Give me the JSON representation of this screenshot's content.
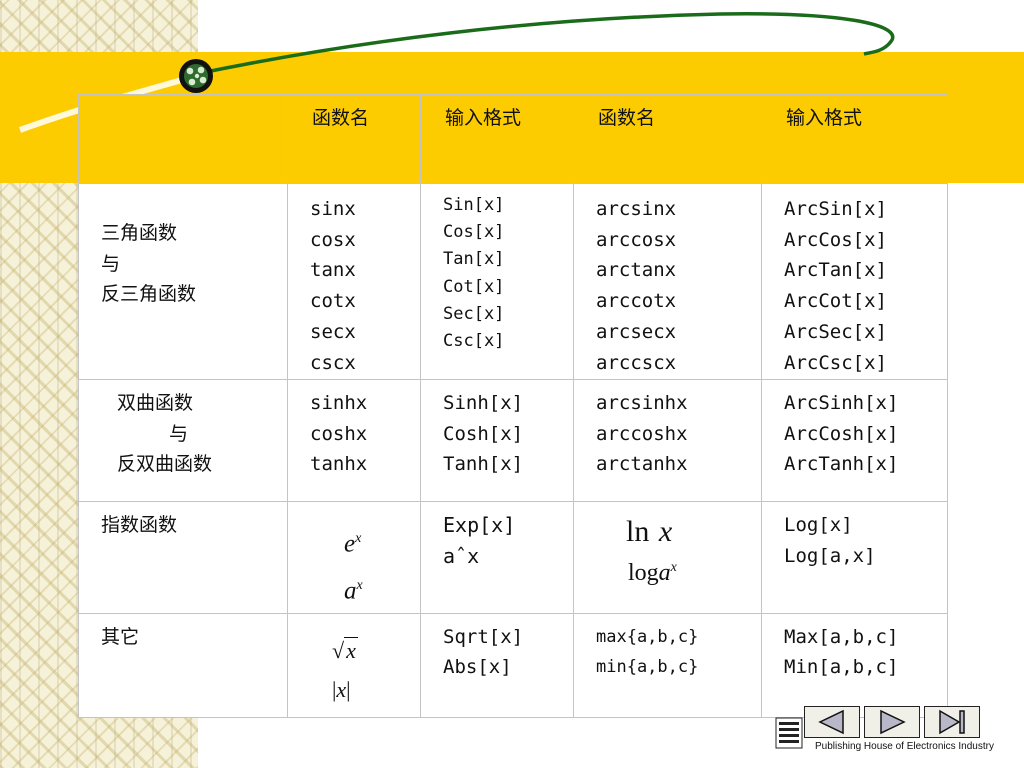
{
  "table": {
    "headers": [
      "函数名",
      "输入格式",
      "函数名",
      "输入格式"
    ],
    "rows": [
      {
        "category": [
          "三角函数",
          "与",
          "反三角函数"
        ],
        "names1": [
          "sinx",
          "cosx",
          "tanx",
          "cotx",
          "secx",
          "cscx"
        ],
        "formats1": [
          "Sin[x]",
          "Cos[x]",
          "Tan[x]",
          "Cot[x]",
          "Sec[x]",
          "Csc[x]"
        ],
        "names2": [
          "arcsinx",
          "arccosx",
          "arctanx",
          "arccotx",
          "arcsecx",
          "arccscx"
        ],
        "formats2": [
          "ArcSin[x]",
          "ArcCos[x]",
          "ArcTan[x]",
          "ArcCot[x]",
          "ArcSec[x]",
          "ArcCsc[x]"
        ]
      },
      {
        "category": [
          "双曲函数",
          "与",
          "反双曲函数"
        ],
        "names1": [
          "sinhx",
          "coshx",
          "tanhx"
        ],
        "formats1": [
          "Sinh[x]",
          "Cosh[x]",
          "Tanh[x]"
        ],
        "names2": [
          "arcsinhx",
          "arccoshx",
          "arctanhx"
        ],
        "formats2": [
          "ArcSinh[x]",
          "ArcCosh[x]",
          "ArcTanh[x]"
        ]
      },
      {
        "category": [
          "指数函数"
        ],
        "names1": [
          {
            "base": "e",
            "sup": "x"
          },
          {
            "base": "a",
            "sup": "x"
          }
        ],
        "formats1": [
          "Exp[x]",
          "aˆx"
        ],
        "names2": [
          {
            "fn": "ln",
            "arg": "x"
          },
          {
            "fn": "log",
            "sub": "a",
            "arg": "x"
          }
        ],
        "formats2": [
          "Log[x]",
          "Log[a,x]"
        ]
      },
      {
        "category": [
          "其它"
        ],
        "names1": [
          {
            "sqrt": "x"
          },
          {
            "abs": "x"
          }
        ],
        "formats1": [
          "Sqrt[x]",
          "Abs[x]"
        ],
        "names2": [
          "max{a,b,c}",
          "min{a,b,c}"
        ],
        "formats2": [
          "Max[a,b,c]",
          "Min[a,b,c]"
        ]
      }
    ]
  },
  "footer": {
    "publisher": "Publishing House of Electronics Industry"
  },
  "nav": {
    "buttons": [
      "prev-icon",
      "next-icon",
      "last-icon"
    ]
  },
  "colors": {
    "accent_yellow": "#fdcc00",
    "decor_green": "#1a6b1a",
    "grid_border": "#c4c4c4"
  }
}
